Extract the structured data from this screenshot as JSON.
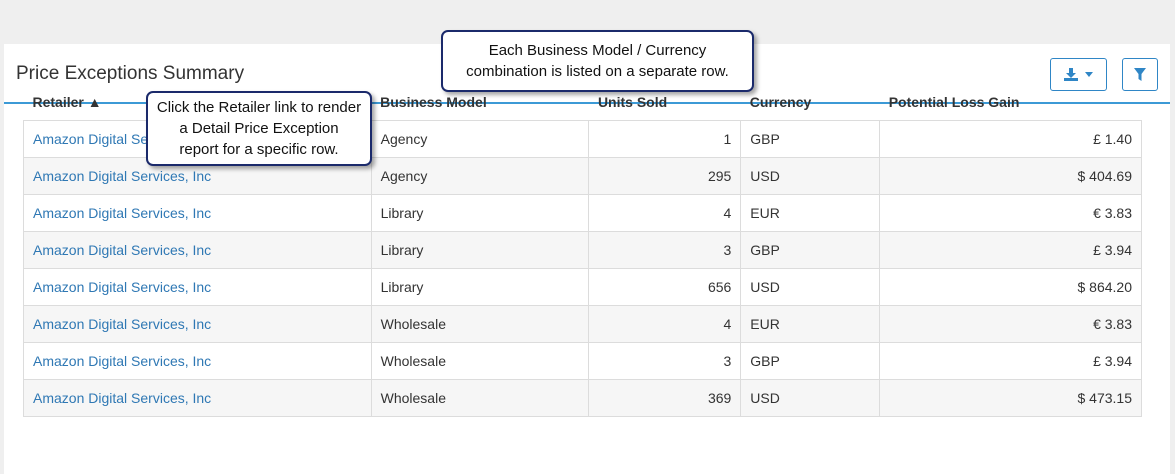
{
  "header": {
    "title": "Price Exceptions Summary"
  },
  "toolbar": {
    "download_icon": "download-icon",
    "caret_icon": "caret-down-icon",
    "filter_icon": "filter-icon",
    "accent": "#2f86c6"
  },
  "table": {
    "columns": [
      "Retailer ▲",
      "Business Model",
      "Units Sold",
      "Currency",
      "Potential Loss Gain"
    ],
    "rows": [
      [
        "Amazon Digital Services, Inc",
        "Agency",
        "1",
        "GBP",
        "£ 1.40"
      ],
      [
        "Amazon Digital Services, Inc",
        "Agency",
        "295",
        "USD",
        "$ 404.69"
      ],
      [
        "Amazon Digital Services, Inc",
        "Library",
        "4",
        "EUR",
        "€ 3.83"
      ],
      [
        "Amazon Digital Services, Inc",
        "Library",
        "3",
        "GBP",
        "£ 3.94"
      ],
      [
        "Amazon Digital Services, Inc",
        "Library",
        "656",
        "USD",
        "$ 864.20"
      ],
      [
        "Amazon Digital Services, Inc",
        "Wholesale",
        "4",
        "EUR",
        "€ 3.83"
      ],
      [
        "Amazon Digital Services, Inc",
        "Wholesale",
        "3",
        "GBP",
        "£ 3.94"
      ],
      [
        "Amazon Digital Services, Inc",
        "Wholesale",
        "369",
        "USD",
        "$ 473.15"
      ]
    ]
  },
  "callouts": {
    "top": [
      "Each Business Model /  Currency",
      "combination is listed on a separate row."
    ],
    "left": [
      "Click the Retailer link to render",
      "a  Detail Price Exception",
      "report for a specific row."
    ]
  }
}
